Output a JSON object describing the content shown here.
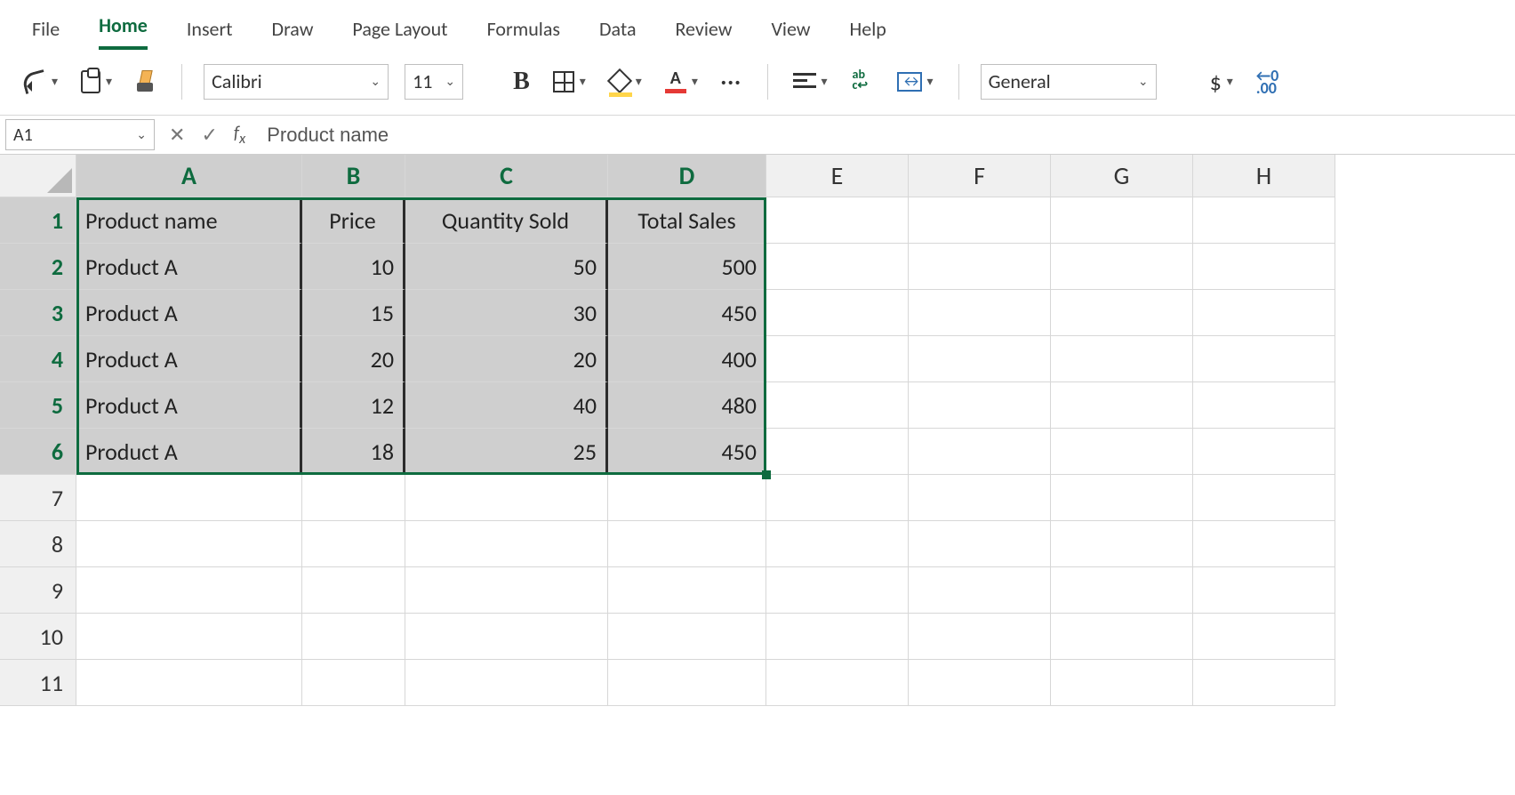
{
  "menu": {
    "tabs": [
      "File",
      "Home",
      "Insert",
      "Draw",
      "Page Layout",
      "Formulas",
      "Data",
      "Review",
      "View",
      "Help"
    ],
    "active": "Home"
  },
  "ribbon": {
    "font_name": "Calibri",
    "font_size": "11",
    "number_format": "General"
  },
  "namebox": "A1",
  "formula_bar": "Product name",
  "columns": [
    "A",
    "B",
    "C",
    "D",
    "E",
    "F",
    "G",
    "H"
  ],
  "selected_cols": [
    "A",
    "B",
    "C",
    "D"
  ],
  "rows": [
    1,
    2,
    3,
    4,
    5,
    6,
    7,
    8,
    9,
    10,
    11
  ],
  "selected_rows": [
    1,
    2,
    3,
    4,
    5,
    6
  ],
  "table": {
    "headers": [
      "Product name",
      "Price",
      "Quantity Sold",
      "Total Sales"
    ],
    "rows": [
      [
        "Product A",
        "10",
        "50",
        "500"
      ],
      [
        "Product A",
        "15",
        "30",
        "450"
      ],
      [
        "Product A",
        "20",
        "20",
        "400"
      ],
      [
        "Product A",
        "12",
        "40",
        "480"
      ],
      [
        "Product A",
        "18",
        "25",
        "450"
      ]
    ]
  },
  "chart_data": {
    "type": "table",
    "title": "",
    "columns": [
      "Product name",
      "Price",
      "Quantity Sold",
      "Total Sales"
    ],
    "rows": [
      {
        "Product name": "Product A",
        "Price": 10,
        "Quantity Sold": 50,
        "Total Sales": 500
      },
      {
        "Product name": "Product A",
        "Price": 15,
        "Quantity Sold": 30,
        "Total Sales": 450
      },
      {
        "Product name": "Product A",
        "Price": 20,
        "Quantity Sold": 20,
        "Total Sales": 400
      },
      {
        "Product name": "Product A",
        "Price": 12,
        "Quantity Sold": 40,
        "Total Sales": 480
      },
      {
        "Product name": "Product A",
        "Price": 18,
        "Quantity Sold": 25,
        "Total Sales": 450
      }
    ]
  }
}
